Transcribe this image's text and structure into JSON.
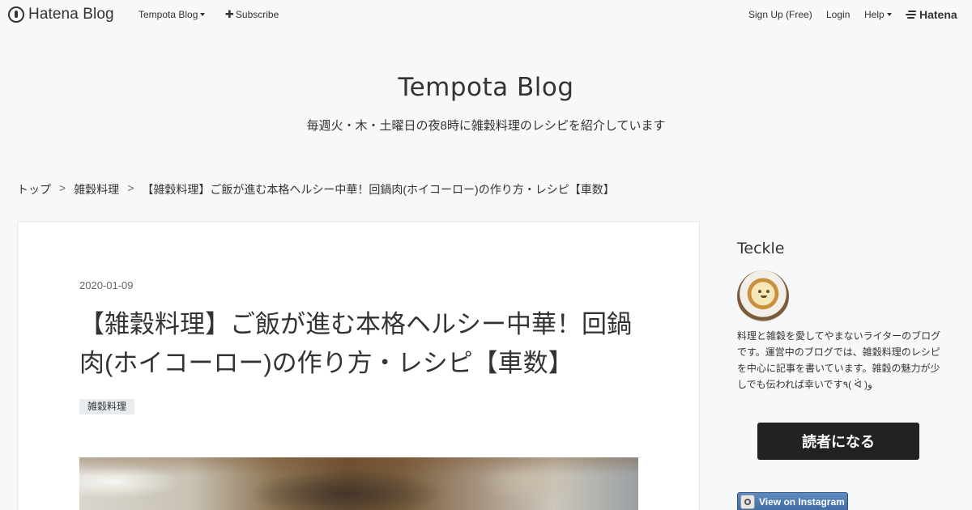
{
  "globalheader": {
    "logo_text": "Hatena Blog",
    "blog_menu_label": "Tempota Blog",
    "subscribe_label": "Subscribe",
    "signup_label": "Sign Up (Free)",
    "login_label": "Login",
    "help_label": "Help",
    "hatena_label": "Hatena"
  },
  "blog": {
    "title": "Tempota Blog",
    "description": "毎週火・木・土曜日の夜8時に雑穀料理のレシピを紹介しています"
  },
  "breadcrumb": {
    "items": [
      "トップ",
      "雑穀料理",
      "【雑穀料理】ご飯が進む本格ヘルシー中華！回鍋肉(ホイコーロー)の作り方・レシピ【車数】"
    ],
    "separator": ">"
  },
  "entry": {
    "date": "2020-01-09",
    "title": "【雑穀料理】ご飯が進む本格ヘルシー中華！回鍋肉(ホイコーロー)の作り方・レシピ【車数】",
    "category": "雑穀料理"
  },
  "sidebar": {
    "profile_title": "Teckle",
    "profile_description": "料理と雑穀を愛してやまないライターのブログです。運営中のブログでは、雑穀料理のレシピを中心に記事を書いています。雑穀の魅力が少しでも伝われば幸いです٩( ᐛ )و",
    "follow_label": "読者になる",
    "instagram_label": "View on Instagram"
  },
  "colors": {
    "background": "#f7f8fa",
    "card": "#ffffff",
    "follow_button": "#222222",
    "instagram_button": "#3f6da3"
  }
}
